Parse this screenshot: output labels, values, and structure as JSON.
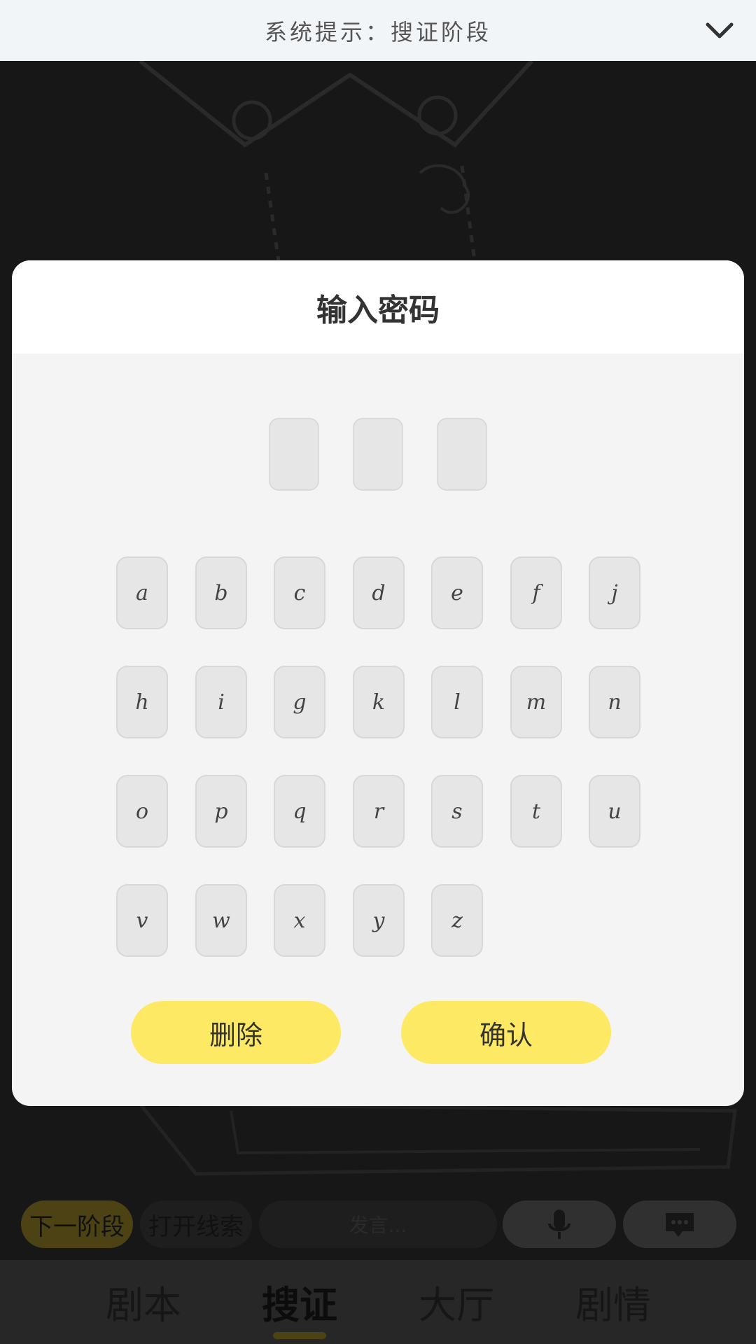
{
  "header": {
    "title": "系统提示：搜证阶段",
    "collapse_icon": "chevron-down-icon"
  },
  "modal": {
    "title": "输入密码",
    "slots": [
      "",
      "",
      ""
    ],
    "keys": [
      "a",
      "b",
      "c",
      "d",
      "e",
      "f",
      "j",
      "h",
      "i",
      "g",
      "k",
      "l",
      "m",
      "n",
      "o",
      "p",
      "q",
      "r",
      "s",
      "t",
      "u",
      "v",
      "w",
      "x",
      "y",
      "z"
    ],
    "delete_label": "删除",
    "confirm_label": "确认"
  },
  "controls": {
    "next_phase_label": "下一阶段",
    "open_clues_label": "打开线索",
    "input_placeholder": "发言...",
    "mic_icon": "microphone-icon",
    "chat_icon": "chat-bubble-icon"
  },
  "tabs": [
    {
      "label": "剧本",
      "active": false
    },
    {
      "label": "搜证",
      "active": true
    },
    {
      "label": "大厅",
      "active": false
    },
    {
      "label": "剧情",
      "active": false
    }
  ],
  "colors": {
    "accent": "#fde964",
    "topbar_bg": "#f2f5f8",
    "overlay": "#1a1a1a"
  }
}
